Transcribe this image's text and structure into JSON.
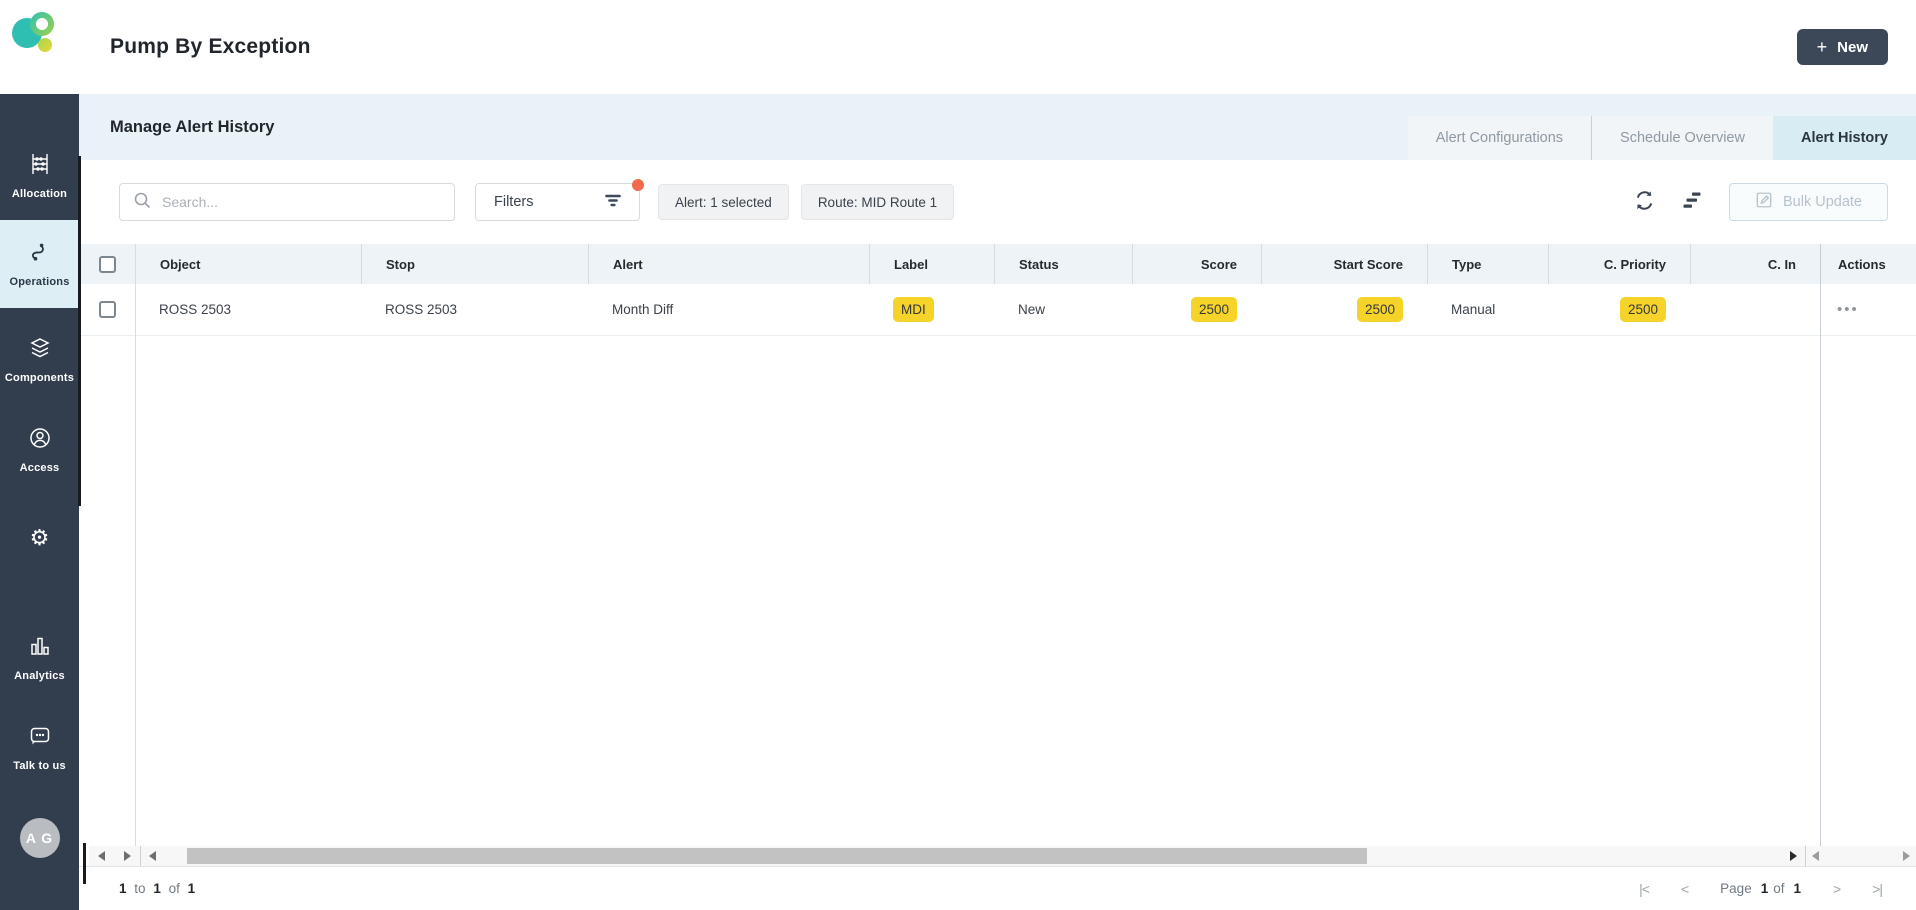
{
  "app": {
    "title": "Pump By Exception",
    "new_label": "New"
  },
  "icons": {
    "plus": "+",
    "more": "•••"
  },
  "sidebar": {
    "items": [
      {
        "label": "Allocation"
      },
      {
        "label": "Operations"
      },
      {
        "label": "Components"
      },
      {
        "label": "Access"
      },
      {
        "label": ""
      },
      {
        "label": "Analytics"
      },
      {
        "label": "Talk to us"
      }
    ],
    "avatar_initials": "A G"
  },
  "page": {
    "title": "Manage Alert History"
  },
  "tabs": [
    {
      "label": "Alert Configurations",
      "active": false
    },
    {
      "label": "Schedule Overview",
      "active": false
    },
    {
      "label": "Alert History",
      "active": true
    }
  ],
  "toolbar": {
    "search_placeholder": "Search...",
    "filters_label": "Filters",
    "chips": [
      "Alert: 1 selected",
      "Route: MID Route 1"
    ],
    "bulk_update_label": "Bulk Update"
  },
  "table": {
    "columns": [
      "",
      "Object",
      "Stop",
      "Alert",
      "Label",
      "Status",
      "Score",
      "Start Score",
      "Type",
      "C. Priority",
      "C. In",
      "Actions"
    ],
    "rows": [
      {
        "object": "ROSS 2503",
        "stop": "ROSS 2503",
        "alert": "Month Diff",
        "label": "MDI",
        "status": "New",
        "score": "2500",
        "start_score": "2500",
        "type": "Manual",
        "c_priority": "2500",
        "c_in": ""
      }
    ]
  },
  "footer": {
    "range": {
      "from": "1",
      "to_word": "to",
      "to": "1",
      "of_word": "of",
      "total": "1"
    },
    "pagination": {
      "first": "|<",
      "prev": "<",
      "page_word": "Page",
      "page": "1",
      "of_word": "of",
      "total": "1",
      "next": ">",
      "last": ">|"
    }
  },
  "colors": {
    "sidebar_bg": "#323e4d",
    "sidebar_active_bg": "#ddeef5",
    "band_bg": "#e9f2f6",
    "tab_active_bg": "#d8ecf4",
    "grid_header_bg": "#edf3f7",
    "badge_yellow": "#f5d328",
    "accent_dot": "#f2694b",
    "new_button_bg": "#3c4857",
    "logo_teal": "#2fbfb2"
  }
}
